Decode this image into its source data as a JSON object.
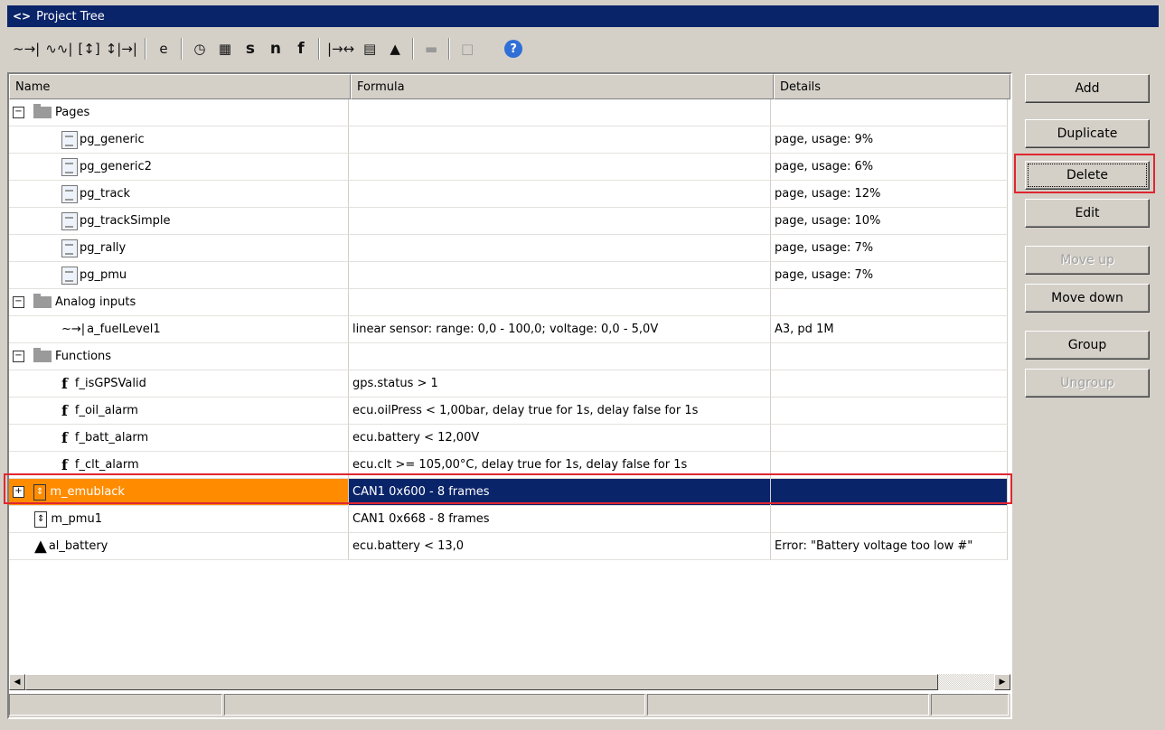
{
  "window": {
    "title": "Project Tree"
  },
  "toolbar": {
    "items": [
      "~→|",
      "∿∿|",
      "[↕]",
      "↕|→|",
      "e",
      "◷",
      "▦",
      "s",
      "n",
      "f",
      "|→↔",
      "▤",
      "▲",
      "▬",
      "□",
      "?"
    ]
  },
  "tree": {
    "columns": {
      "name": "Name",
      "formula": "Formula",
      "details": "Details"
    },
    "rows": [
      {
        "type": "group",
        "name": "Pages",
        "formula": "",
        "details": ""
      },
      {
        "type": "page",
        "name": "pg_generic",
        "formula": "",
        "details": "page, usage: 9%"
      },
      {
        "type": "page",
        "name": "pg_generic2",
        "formula": "",
        "details": "page, usage: 6%"
      },
      {
        "type": "page",
        "name": "pg_track",
        "formula": "",
        "details": "page, usage: 12%"
      },
      {
        "type": "page",
        "name": "pg_trackSimple",
        "formula": "",
        "details": "page, usage: 10%"
      },
      {
        "type": "page",
        "name": "pg_rally",
        "formula": "",
        "details": "page, usage: 7%"
      },
      {
        "type": "page",
        "name": "pg_pmu",
        "formula": "",
        "details": "page, usage: 7%"
      },
      {
        "type": "group",
        "name": "Analog inputs",
        "formula": "",
        "details": ""
      },
      {
        "type": "analog",
        "name": "a_fuelLevel1",
        "formula": "linear sensor: range: 0,0 - 100,0;  voltage: 0,0 - 5,0V",
        "details": "A3, pd 1M"
      },
      {
        "type": "group",
        "name": "Functions",
        "formula": "",
        "details": ""
      },
      {
        "type": "function",
        "name": "f_isGPSValid",
        "formula": "gps.status > 1",
        "details": ""
      },
      {
        "type": "function",
        "name": "f_oil_alarm",
        "formula": "ecu.oilPress < 1,00bar, delay true for 1s, delay false for 1s",
        "details": ""
      },
      {
        "type": "function",
        "name": "f_batt_alarm",
        "formula": "ecu.battery < 12,00V",
        "details": ""
      },
      {
        "type": "function",
        "name": "f_clt_alarm",
        "formula": "ecu.clt >= 105,00°C, delay true for 1s, delay false for 1s",
        "details": ""
      },
      {
        "type": "message",
        "name": "m_emublack",
        "formula": "CAN1 0x600 - 8 frames",
        "details": "",
        "selected": true
      },
      {
        "type": "message",
        "name": "m_pmu1",
        "formula": "CAN1 0x668 - 8 frames",
        "details": ""
      },
      {
        "type": "alarm",
        "name": "al_battery",
        "formula": "ecu.battery < 13,0",
        "details": "Error: \"Battery voltage too low #\""
      }
    ]
  },
  "buttons": {
    "add": "Add",
    "duplicate": "Duplicate",
    "delete": "Delete",
    "edit": "Edit",
    "move_up": "Move up",
    "move_down": "Move down",
    "group": "Group",
    "ungroup": "Ungroup"
  },
  "colors": {
    "title_bar": "#0a246a",
    "selection_name": "#ff8c00",
    "selection": "#0a246a",
    "highlight": "#e0262f"
  }
}
